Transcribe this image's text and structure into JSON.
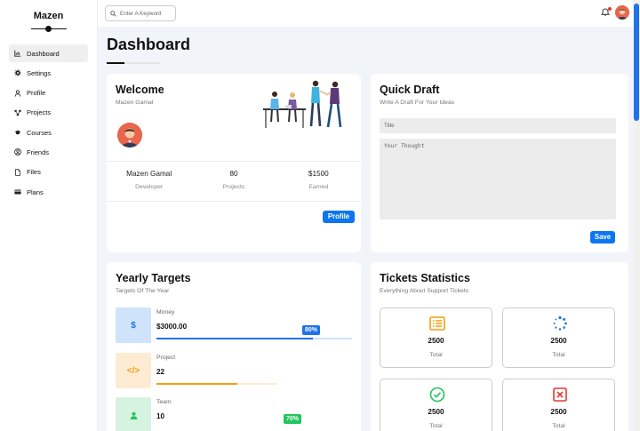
{
  "sidebar": {
    "brand": "Mazen",
    "items": [
      {
        "label": "Dashboard",
        "icon": "chart-icon"
      },
      {
        "label": "Settings",
        "icon": "gear-icon"
      },
      {
        "label": "Profile",
        "icon": "user-icon"
      },
      {
        "label": "Projects",
        "icon": "diagram-icon"
      },
      {
        "label": "Courses",
        "icon": "graduation-cap-icon"
      },
      {
        "label": "Friends",
        "icon": "friends-icon"
      },
      {
        "label": "Files",
        "icon": "file-icon"
      },
      {
        "label": "Plans",
        "icon": "credit-card-icon"
      }
    ],
    "active_index": 0
  },
  "header": {
    "search_placeholder": "Enter A Keyword",
    "notification_dot_color": "#e53935"
  },
  "page": {
    "title": "Dashboard"
  },
  "welcome": {
    "title": "Welcome",
    "name": "Mazen Gamal",
    "stats": [
      {
        "value": "Mazen Gamal",
        "label": "Developer"
      },
      {
        "value": "80",
        "label": "Projects"
      },
      {
        "value": "$1500",
        "label": "Earned"
      }
    ],
    "profile_button": "Profile"
  },
  "draft": {
    "title": "Quick Draft",
    "subtitle": "Write A Draft For Your Ideas",
    "title_placeholder": "Title",
    "body_placeholder": "Your Thought",
    "save_button": "Save"
  },
  "yearly": {
    "title": "Yearly Targets",
    "subtitle": "Targets Of The Year",
    "targets": [
      {
        "label": "Money",
        "value": "$3000.00",
        "icon": "dollar-icon",
        "color": "#1e73e8",
        "bg": "#cfe3fb",
        "progress": 0.8,
        "badge": "80%"
      },
      {
        "label": "Project",
        "value": "22",
        "icon": "code-icon",
        "color": "#f59e0b",
        "bg": "#fdecd3",
        "progress": 0.67,
        "badge": ""
      },
      {
        "label": "Team",
        "value": "10",
        "icon": "user-icon",
        "color": "#22c55e",
        "bg": "#d6f3df",
        "progress": 0.7,
        "badge": "70%"
      }
    ]
  },
  "tickets": {
    "title": "Tickets Statistics",
    "subtitle": "Everything About Support Tickets",
    "boxes": [
      {
        "value": "2500",
        "label": "Total",
        "icon": "list-icon",
        "color": "#f59e0b"
      },
      {
        "value": "2500",
        "label": "Total",
        "icon": "spinner-icon",
        "color": "#1e73e8"
      },
      {
        "value": "2500",
        "label": "Total",
        "icon": "check-circle-icon",
        "color": "#22c55e"
      },
      {
        "value": "2500",
        "label": "Total",
        "icon": "close-square-icon",
        "color": "#e53935"
      }
    ]
  }
}
